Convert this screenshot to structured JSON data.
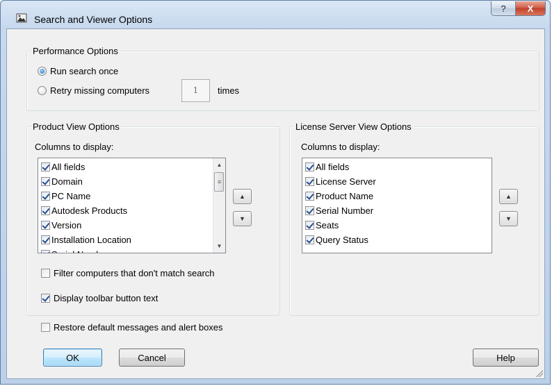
{
  "window": {
    "title": "Search and Viewer Options",
    "help_glyph": "?",
    "close_glyph": "X"
  },
  "performance": {
    "legend": "Performance Options",
    "run_once_label": "Run search once",
    "retry_label": "Retry missing computers",
    "retry_count": "1",
    "times_label": "times",
    "selected": "run_once"
  },
  "product_view": {
    "legend": "Product View Options",
    "columns_label": "Columns to display:",
    "items": [
      {
        "label": "All fields",
        "checked": true
      },
      {
        "label": "Domain",
        "checked": true
      },
      {
        "label": "PC Name",
        "checked": true
      },
      {
        "label": "Autodesk Products",
        "checked": true
      },
      {
        "label": "Version",
        "checked": true
      },
      {
        "label": "Installation Location",
        "checked": true
      },
      {
        "label": "Serial Number",
        "checked": true
      }
    ],
    "filter_label": "Filter computers that don't match search",
    "filter_checked": false,
    "toolbar_text_label": "Display toolbar button text",
    "toolbar_text_checked": true
  },
  "license_view": {
    "legend": "License Server View Options",
    "columns_label": "Columns to display:",
    "items": [
      {
        "label": "All fields",
        "checked": true
      },
      {
        "label": "License Server",
        "checked": true
      },
      {
        "label": "Product Name",
        "checked": true
      },
      {
        "label": "Serial Number",
        "checked": true
      },
      {
        "label": "Seats",
        "checked": true
      },
      {
        "label": "Query Status",
        "checked": true
      }
    ]
  },
  "restore": {
    "label": "Restore default messages and alert boxes",
    "checked": false
  },
  "buttons": {
    "ok": "OK",
    "cancel": "Cancel",
    "help": "Help"
  },
  "glyphs": {
    "up": "▲",
    "down": "▼",
    "grip": "≡"
  },
  "colors": {
    "title_bar": "#c6d8ee",
    "close_red": "#c2412b",
    "default_button": "#3c7fb1",
    "checkmark": "#2a4d8c"
  }
}
